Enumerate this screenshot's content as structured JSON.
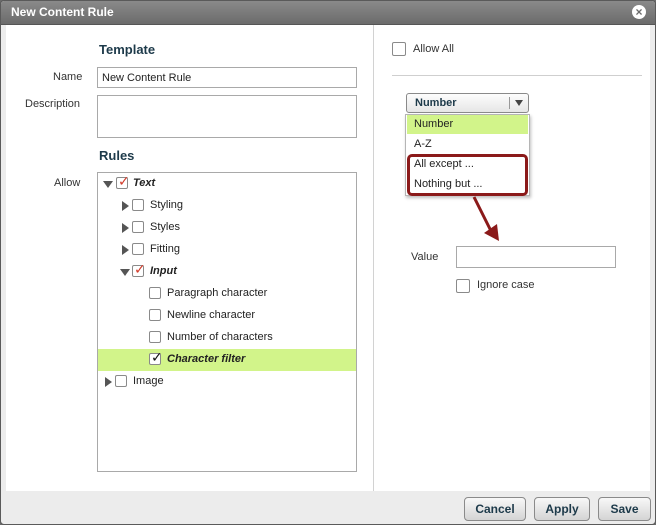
{
  "dialog": {
    "title": "New Content Rule"
  },
  "template": {
    "heading": "Template",
    "name_label": "Name",
    "name_value": "New Content Rule",
    "description_label": "Description",
    "description_value": ""
  },
  "rules": {
    "heading": "Rules",
    "allow_label": "Allow",
    "tree": [
      {
        "label": "Text",
        "checked": true
      },
      {
        "label": "Styling",
        "checked": false
      },
      {
        "label": "Styles",
        "checked": false
      },
      {
        "label": "Fitting",
        "checked": false
      },
      {
        "label": "Input",
        "checked": true
      },
      {
        "label": "Paragraph character",
        "checked": false
      },
      {
        "label": "Newline character",
        "checked": false
      },
      {
        "label": "Number of characters",
        "checked": false
      },
      {
        "label": "Character filter",
        "checked": true,
        "selected": true
      },
      {
        "label": "Image",
        "checked": false
      }
    ]
  },
  "right_panel": {
    "allow_all_label": "Allow All",
    "allow_all_checked": false,
    "dropdown": {
      "selected": "Number",
      "options": [
        "Number",
        "A-Z",
        "All except ...",
        "Nothing but ..."
      ],
      "highlighted_index": 0
    },
    "value_label": "Value",
    "value_input": "",
    "ignore_case_label": "Ignore case",
    "ignore_case_checked": false
  },
  "footer": {
    "cancel_label": "Cancel",
    "apply_label": "Apply",
    "save_label": "Save"
  },
  "colors": {
    "selection_green": "#d2f48a",
    "annotation_red": "#8b1a1a",
    "heading_navy": "#1d3a4a"
  }
}
